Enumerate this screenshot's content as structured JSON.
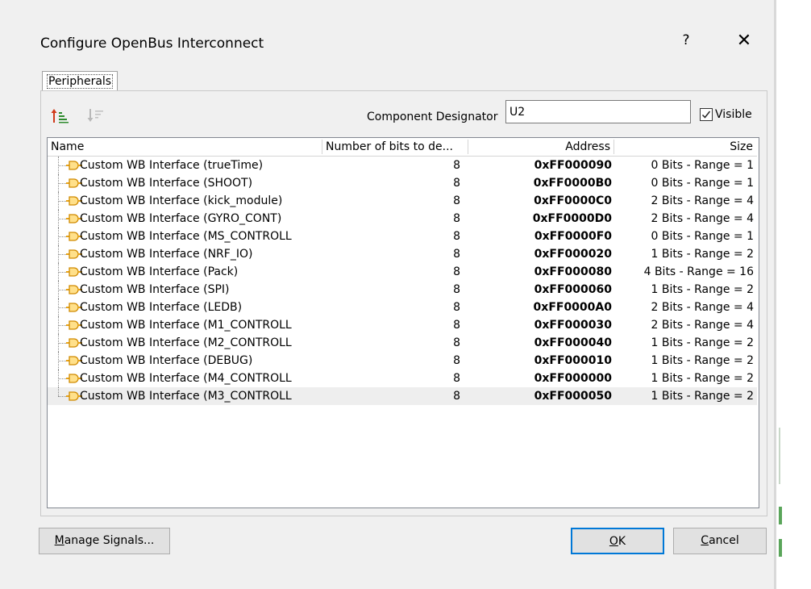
{
  "window": {
    "title": "Configure OpenBus Interconnect",
    "help_glyph": "?",
    "close_glyph": "✕"
  },
  "tabs": [
    {
      "label": "Peripherals",
      "selected": true
    }
  ],
  "toolbar": {
    "sort_up_icon": "move-up-icon",
    "sort_down_icon": "move-down-icon"
  },
  "designator": {
    "label": "Component Designator",
    "value": "U2"
  },
  "visible_checkbox": {
    "label": "Visible",
    "checked": true
  },
  "table": {
    "columns": [
      "Name",
      "Number of bits to de...",
      "Address",
      "Size"
    ],
    "rows": [
      {
        "name": "Custom WB Interface (trueTime)",
        "bits": "8",
        "address": "0xFF000090",
        "size": "0 Bits - Range = 1"
      },
      {
        "name": "Custom WB Interface (SHOOT)",
        "bits": "8",
        "address": "0xFF0000B0",
        "size": "0 Bits - Range = 1"
      },
      {
        "name": "Custom WB Interface (kick_module)",
        "bits": "8",
        "address": "0xFF0000C0",
        "size": "2 Bits - Range = 4"
      },
      {
        "name": "Custom WB Interface (GYRO_CONT)",
        "bits": "8",
        "address": "0xFF0000D0",
        "size": "2 Bits - Range = 4"
      },
      {
        "name": "Custom WB Interface (MS_CONTROLL",
        "bits": "8",
        "address": "0xFF0000F0",
        "size": "0 Bits - Range = 1"
      },
      {
        "name": "Custom WB Interface (NRF_IO)",
        "bits": "8",
        "address": "0xFF000020",
        "size": "1 Bits - Range = 2"
      },
      {
        "name": "Custom WB Interface (Pack)",
        "bits": "8",
        "address": "0xFF000080",
        "size": "4 Bits - Range = 16"
      },
      {
        "name": "Custom WB Interface (SPI)",
        "bits": "8",
        "address": "0xFF000060",
        "size": "1 Bits - Range = 2"
      },
      {
        "name": "Custom WB Interface (LEDB)",
        "bits": "8",
        "address": "0xFF0000A0",
        "size": "2 Bits - Range = 4"
      },
      {
        "name": "Custom WB Interface (M1_CONTROLL",
        "bits": "8",
        "address": "0xFF000030",
        "size": "2 Bits - Range = 4"
      },
      {
        "name": "Custom WB Interface (M2_CONTROLL",
        "bits": "8",
        "address": "0xFF000040",
        "size": "1 Bits - Range = 2"
      },
      {
        "name": "Custom WB Interface (DEBUG)",
        "bits": "8",
        "address": "0xFF000010",
        "size": "1 Bits - Range = 2"
      },
      {
        "name": "Custom WB Interface (M4_CONTROLL",
        "bits": "8",
        "address": "0xFF000000",
        "size": "1 Bits - Range = 2"
      },
      {
        "name": "Custom WB Interface (M3_CONTROLL",
        "bits": "8",
        "address": "0xFF000050",
        "size": "1 Bits - Range = 2"
      }
    ],
    "selected_row": 13
  },
  "buttons": {
    "manage_signals_accel": "M",
    "manage_signals_rest": "anage Signals...",
    "ok_accel": "O",
    "ok_rest": "K",
    "cancel_accel": "C",
    "cancel_rest": "ancel"
  },
  "colors": {
    "dialog_bg": "#f0f0f0",
    "focus_border": "#0078d7",
    "icon_orange": "#e8a317",
    "sort_up_green": "#2e8b2e",
    "sort_up_red": "#d03a1a"
  }
}
